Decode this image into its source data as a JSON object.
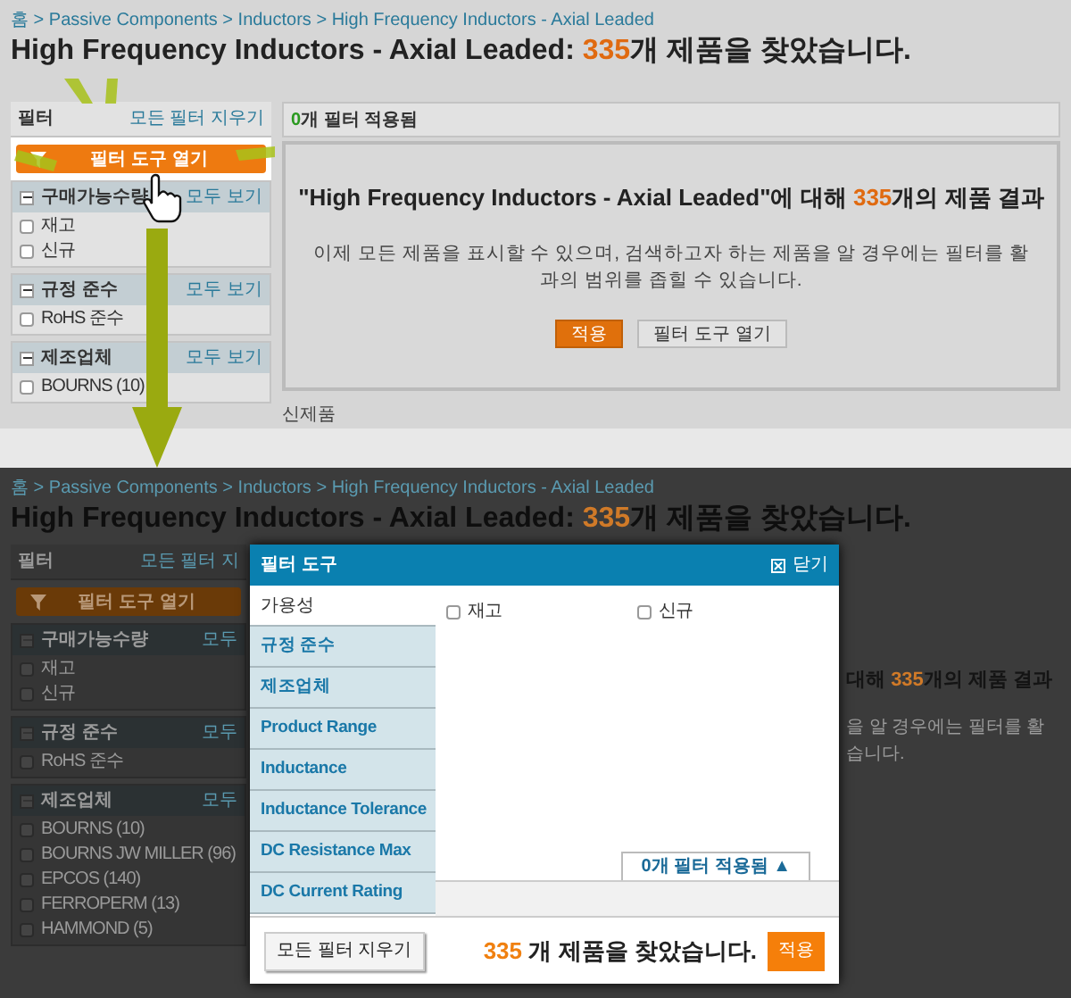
{
  "top_page": {
    "breadcrumb": "홈 > Passive Components > Inductors > High Frequency Inductors - Axial Leaded",
    "title": {
      "name": "High Frequency Inductors - Axial Leaded: ",
      "count": "335",
      "suffix": "개 제품을 찾았습니다."
    },
    "sidebar": {
      "title": "필터",
      "clear_link": "모든 필터 지우기",
      "open_button": "필터 도구 열기",
      "highlighted": true,
      "sections": [
        {
          "title": "구매가능수량",
          "expanded": true,
          "view_all": "모두 보기",
          "options": [
            {
              "label": "재고",
              "checked": false
            },
            {
              "label": "신규",
              "checked": false
            }
          ]
        },
        {
          "title": "규정 준수",
          "expanded": true,
          "view_all": "모두 보기",
          "options": [
            {
              "label": "RoHS 준수",
              "checked": false
            }
          ]
        },
        {
          "title": "제조업체",
          "expanded": true,
          "view_all": "모두 보기",
          "options": [
            {
              "label": "BOURNS (10)",
              "checked": false
            }
          ]
        }
      ]
    },
    "results": {
      "applied_count": "0",
      "applied_label": "개 필터 적용됨",
      "heading": {
        "prefix": "\"High Frequency Inductors - Axial Leaded\"에 대해 ",
        "count": "335",
        "suffix": "개의 제품 결과"
      },
      "lines": [
        "이제 모든 제품을 표시할 수 있으며, 검색하고자 하는 제품을 알 경우에는 필터를 활",
        "과의 범위를 좁힐 수 있습니다."
      ],
      "buttons": [
        {
          "label": "적용",
          "kind": "primary"
        },
        {
          "label": "필터 도구 열기",
          "kind": "secondary"
        }
      ],
      "new_products": "신제품"
    }
  },
  "bottom_page": {
    "breadcrumb": "홈 > Passive Components > Inductors > High Frequency Inductors - Axial Leaded",
    "title": {
      "name": "High Frequency Inductors - Axial Leaded: ",
      "count": "335",
      "suffix": "개 제품을 찾았습니다."
    },
    "sidebar": {
      "title": "필터",
      "clear_link": "모든 필터 지",
      "open_button": "필터 도구 열기",
      "highlighted": false,
      "sections": [
        {
          "title": "구매가능수량",
          "expanded": true,
          "view_all": "모두",
          "options": [
            {
              "label": "재고",
              "checked": false
            },
            {
              "label": "신규",
              "checked": false
            }
          ]
        },
        {
          "title": "규정 준수",
          "expanded": true,
          "view_all": "모두",
          "options": [
            {
              "label": "RoHS 준수",
              "checked": false
            }
          ]
        },
        {
          "title": "제조업체",
          "expanded": true,
          "view_all": "모두",
          "options": [
            {
              "label": "BOURNS (10)",
              "checked": false
            },
            {
              "label": "BOURNS JW MILLER (96)",
              "checked": false
            },
            {
              "label": "EPCOS (140)",
              "checked": false
            },
            {
              "label": "FERROPERM (13)",
              "checked": false
            },
            {
              "label": "HAMMOND (5)",
              "checked": false
            }
          ]
        }
      ]
    },
    "results": {
      "heading": {
        "prefix": "대해 ",
        "count": "335",
        "suffix": "개의 제품 결과"
      },
      "lines": [
        "을 알 경우에는 필터를 활",
        "습니다."
      ]
    }
  },
  "modal": {
    "title": "필터 도구",
    "close": "닫기",
    "tabs": [
      {
        "label": "가용성",
        "selected": true
      },
      {
        "label": "규정 준수",
        "selected": false
      },
      {
        "label": "제조업체",
        "selected": false
      },
      {
        "label": "Product Range",
        "selected": false
      },
      {
        "label": "Inductance",
        "selected": false
      },
      {
        "label": "Inductance Tolerance",
        "selected": false
      },
      {
        "label": "DC Resistance Max",
        "selected": false
      },
      {
        "label": "DC Current Rating",
        "selected": false
      }
    ],
    "options": [
      {
        "label": "재고",
        "checked": false
      },
      {
        "label": "신규",
        "checked": false
      }
    ],
    "applied_tab": {
      "count": "0",
      "label": "개 필터 적용됨 ▲"
    },
    "clear_button": "모든 필터 지우기",
    "found": {
      "count": "335",
      "label": "개 제품을 찾았습니다."
    },
    "apply_button": "적용"
  }
}
